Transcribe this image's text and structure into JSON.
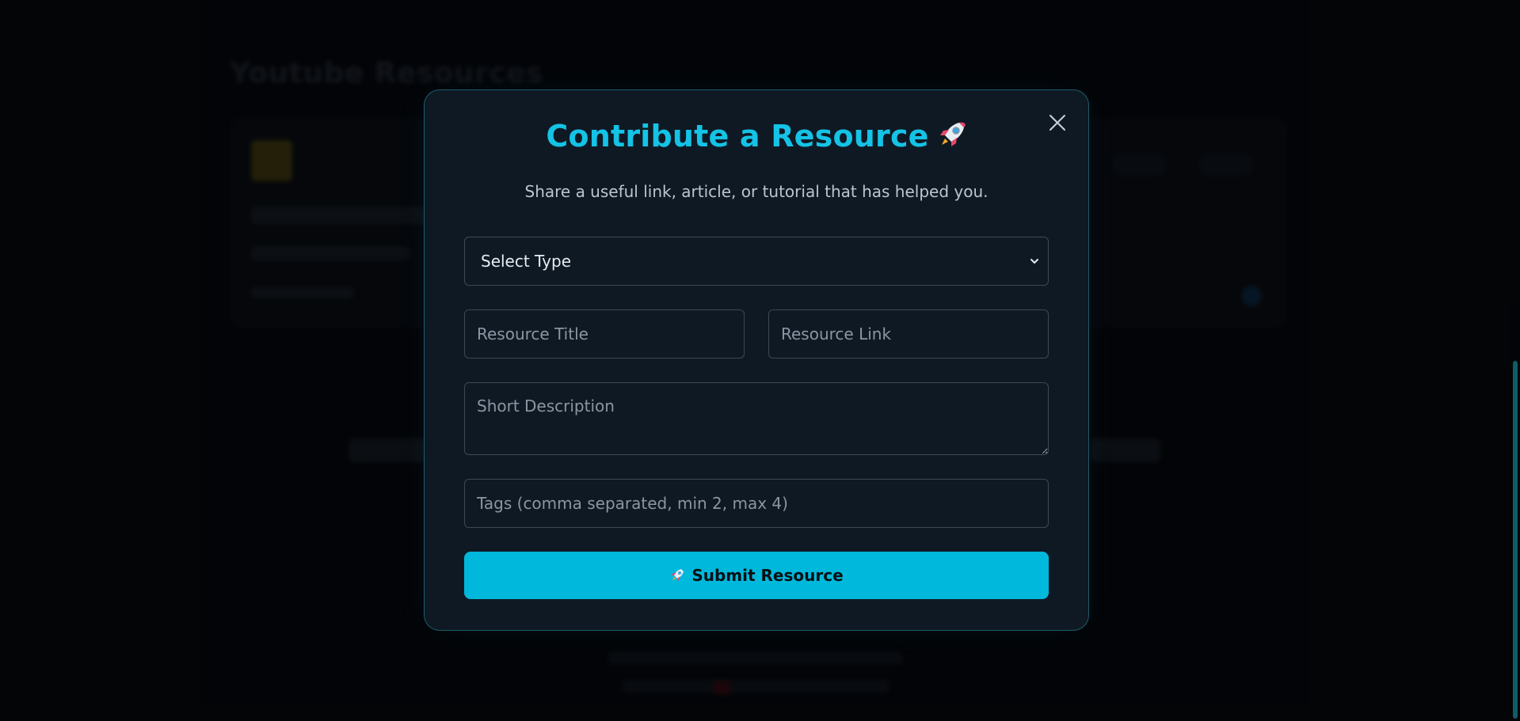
{
  "background": {
    "heading": "Youtube Resources"
  },
  "modal": {
    "title": "Contribute a Resource",
    "title_icon": "rocket-icon",
    "subtitle": "Share a useful link, article, or tutorial that has helped you.",
    "type_select": {
      "selected": "Select Type"
    },
    "title_input": {
      "placeholder": "Resource Title",
      "value": ""
    },
    "link_input": {
      "placeholder": "Resource Link",
      "value": ""
    },
    "description_input": {
      "placeholder": "Short Description",
      "value": ""
    },
    "tags_input": {
      "placeholder": "Tags (comma separated, min 2, max 4)",
      "value": ""
    },
    "submit_label": "Submit Resource",
    "submit_icon": "rocket-icon",
    "close_icon": "close-icon"
  },
  "colors": {
    "accent": "#14c3e6",
    "button": "#00b8db",
    "modal_bg": "#0f1924",
    "border": "#1e5b6c"
  }
}
